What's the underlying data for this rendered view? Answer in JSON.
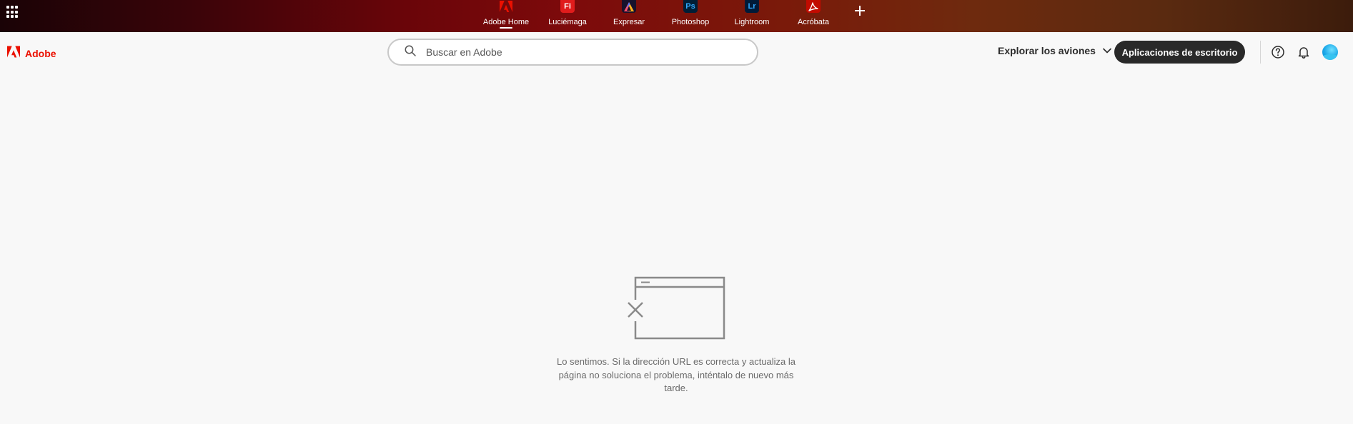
{
  "app_switcher": {
    "apps": [
      {
        "label": "Adobe Home",
        "icon": "adobe-logo-icon",
        "active": true
      },
      {
        "label": "Luciémaga",
        "icon": "firefly-icon",
        "icon_text": "Fi",
        "color": "#e01c1c"
      },
      {
        "label": "Expresar",
        "icon": "express-icon",
        "color": "#17122c"
      },
      {
        "label": "Photoshop",
        "icon": "photoshop-icon",
        "icon_text": "Ps",
        "color": "#001e36"
      },
      {
        "label": "Lightroom",
        "icon": "lightroom-icon",
        "icon_text": "Lr",
        "color": "#001a38"
      },
      {
        "label": "Acróbata",
        "icon": "acrobat-icon",
        "color": "#eb1000"
      }
    ]
  },
  "header": {
    "brand": "Adobe",
    "brand_color": "#eb1000",
    "search": {
      "placeholder": "Buscar en Adobe"
    },
    "explore_label": "Explorar los aviones",
    "desktop_apps_label": "Aplicaciones de escritorio"
  },
  "error": {
    "message": "Lo sentimos. Si la dirección URL es correcta y actualiza la página no soluciona el problema, inténtalo de nuevo más tarde."
  }
}
